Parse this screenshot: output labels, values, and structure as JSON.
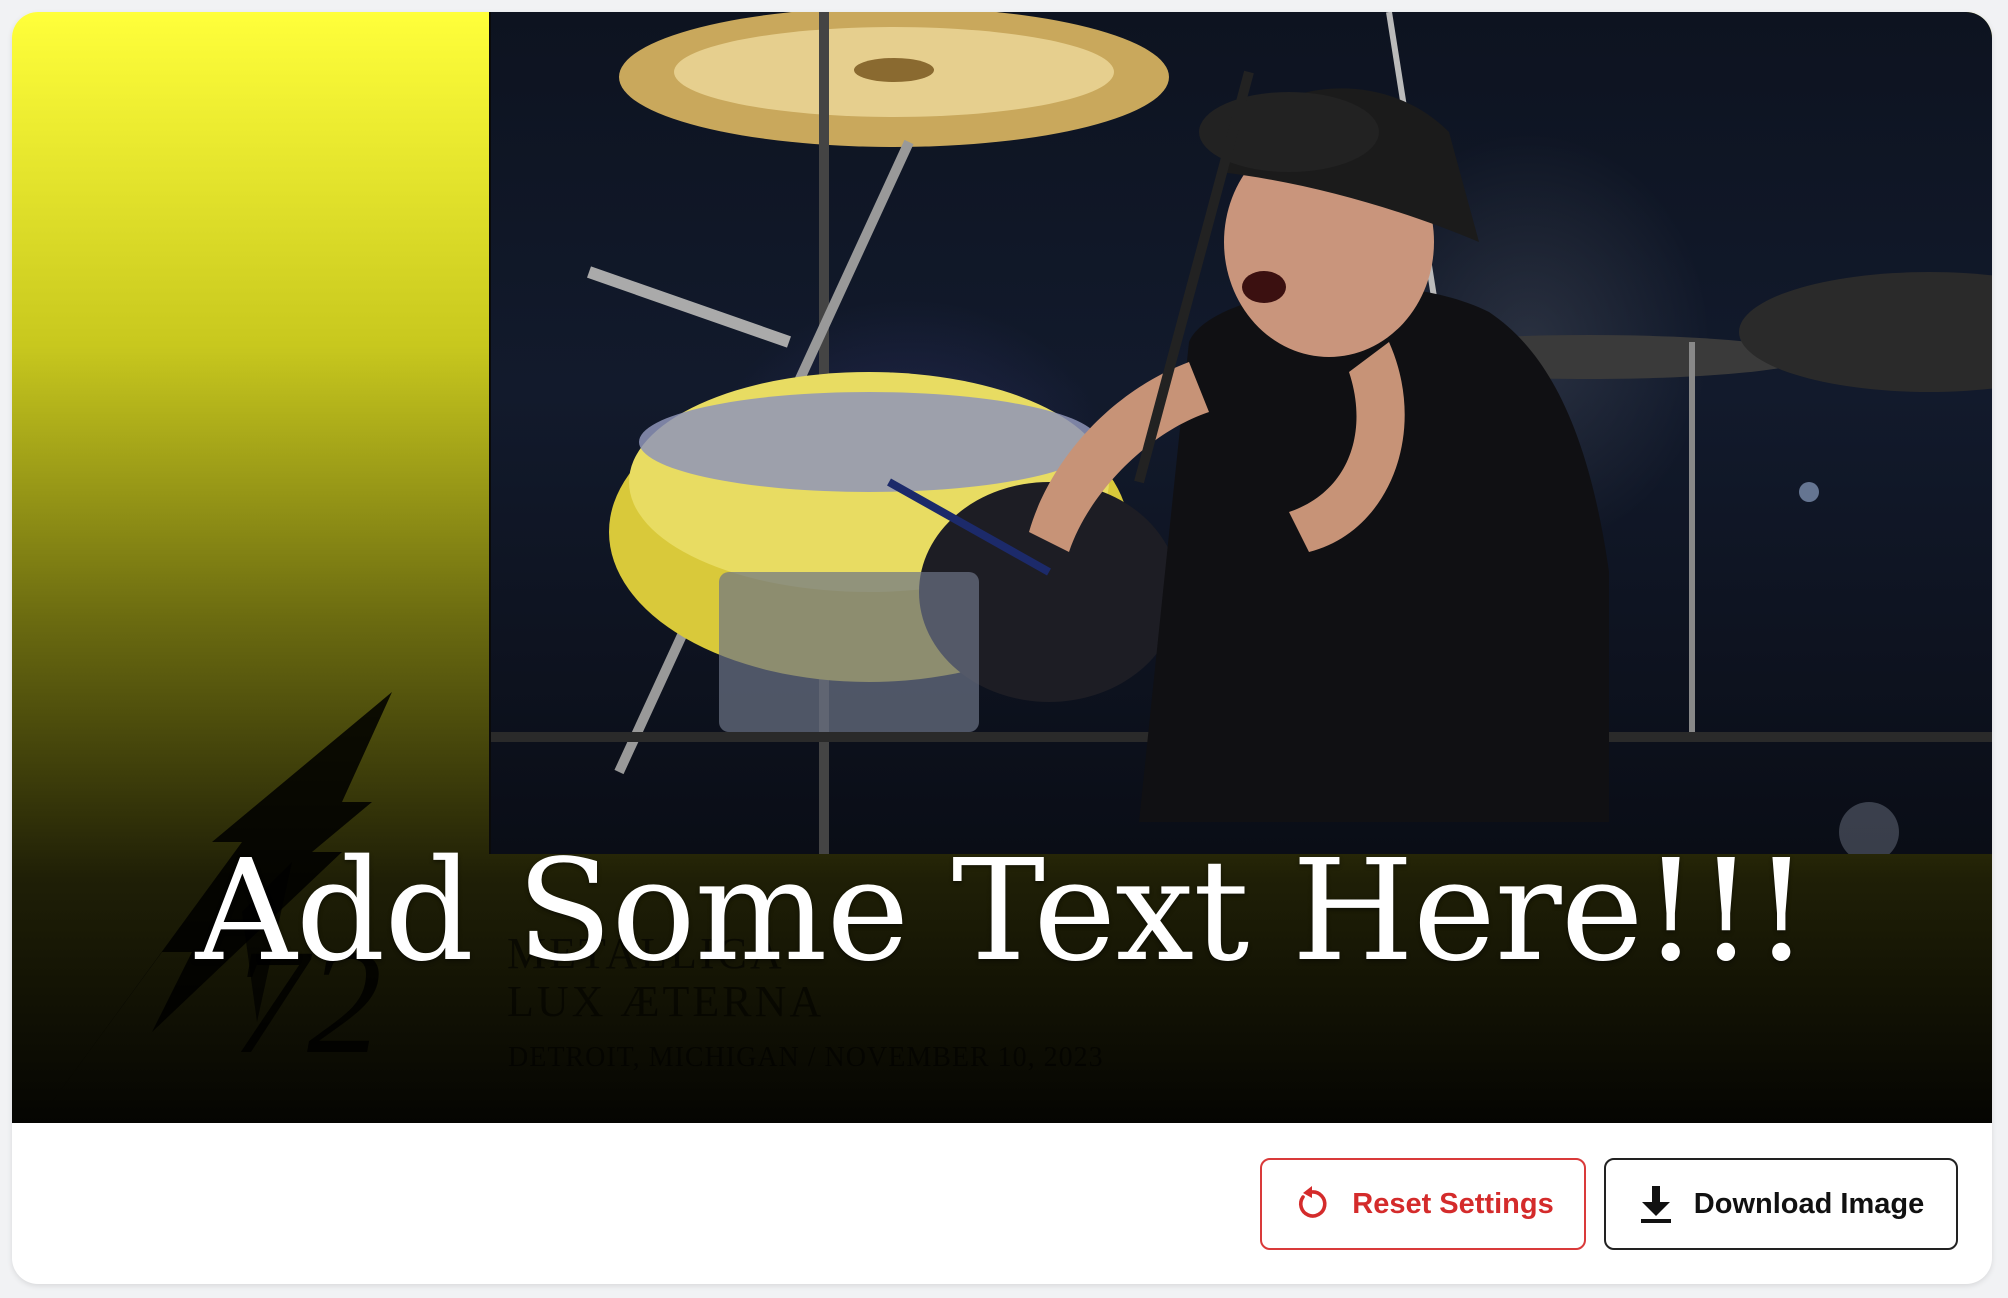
{
  "poster": {
    "headline": "Add Some Text Here!!!",
    "subtitle_line1": "METALLICA",
    "subtitle_line2": "LUX ÆTERNA",
    "meta": "DETROIT, MICHIGAN / NOVEMBER 10, 2023",
    "logo_text": "M72",
    "background_top": "#ffff3a",
    "background_bottom": "#050502"
  },
  "actions": {
    "reset_label": "Reset Settings",
    "reset_icon": "reset-icon",
    "reset_color": "#d42b2b",
    "download_label": "Download Image",
    "download_icon": "download-icon"
  }
}
